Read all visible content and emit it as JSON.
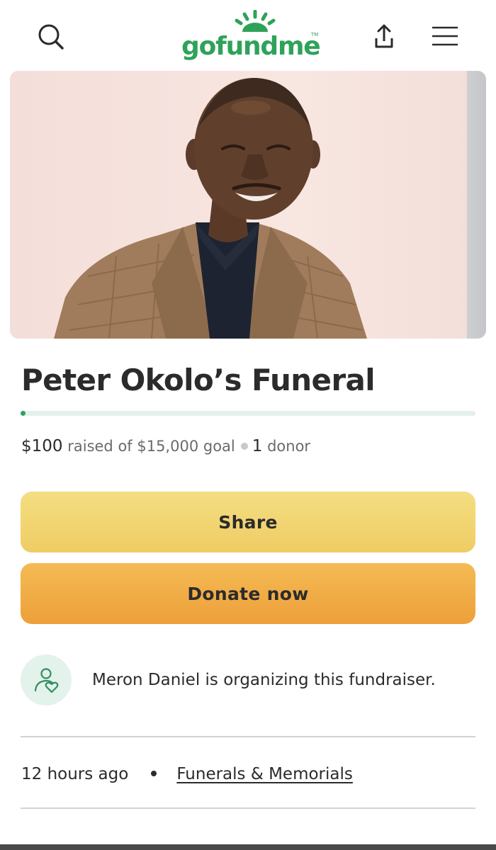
{
  "header": {
    "logo_text": "gofundme",
    "logo_tm": "TM",
    "search_icon": "search-icon",
    "share_icon": "upload-share-icon",
    "menu_icon": "hamburger-menu-icon"
  },
  "campaign": {
    "title": "Peter Okolo’s Funeral",
    "raised_amount": "$100",
    "raised_text": "raised of $15,000 goal",
    "donor_count": "1",
    "donor_label": "donor",
    "progress_fraction": 0.0067
  },
  "actions": {
    "share_label": "Share",
    "donate_label": "Donate now"
  },
  "organizer": {
    "text": "Meron Daniel is organizing this fundraiser.",
    "icon": "organizer-heart-person-icon"
  },
  "meta": {
    "time_ago": "12 hours ago",
    "category": "Funerals & Memorials"
  },
  "colors": {
    "brand_green": "#2fa25a",
    "share_yellow": "#f2d572",
    "donate_orange": "#f0ad47",
    "text_dark": "#2b2b2b"
  }
}
